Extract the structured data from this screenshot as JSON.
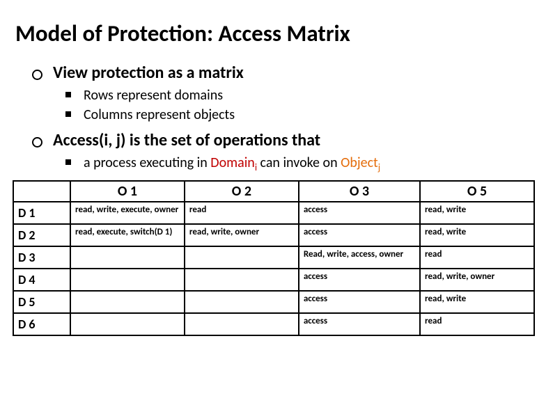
{
  "title": "Model of Protection: Access Matrix",
  "bullets": {
    "b1": {
      "text": "View protection as a matrix",
      "sub": {
        "s1": "Rows represent domains",
        "s2": "Columns represent objects"
      }
    },
    "b2": {
      "text": "Access(i, j) is the set of operations that",
      "sub_prefix": "a process executing in ",
      "sub_domain": "Domain",
      "sub_i": "i",
      "sub_mid": " can invoke on ",
      "sub_object": "Object",
      "sub_j": "j"
    }
  },
  "table": {
    "headers": {
      "h0": "",
      "h1": "O 1",
      "h2": "O 2",
      "h3": "O 3",
      "h4": "O 5"
    },
    "rows": [
      {
        "label": "D 1",
        "c1": "read, write, execute, owner",
        "c2": "read",
        "c3": "access",
        "c4": "read, write"
      },
      {
        "label": "D 2",
        "c1": "read, execute, switch(D 1)",
        "c2": "read, write, owner",
        "c3": "access",
        "c4": "read, write"
      },
      {
        "label": "D 3",
        "c1": "",
        "c2": "",
        "c3": "Read, write, access, owner",
        "c4": "read"
      },
      {
        "label": "D 4",
        "c1": "",
        "c2": "",
        "c3": "access",
        "c4": "read, write, owner"
      },
      {
        "label": "D 5",
        "c1": "",
        "c2": "",
        "c3": "access",
        "c4": "read, write"
      },
      {
        "label": "D 6",
        "c1": "",
        "c2": "",
        "c3": "access",
        "c4": "read"
      }
    ]
  },
  "chart_data": {
    "type": "table",
    "columns": [
      "O 1",
      "O 2",
      "O 3",
      "O 5"
    ],
    "rows": [
      "D 1",
      "D 2",
      "D 3",
      "D 4",
      "D 5",
      "D 6"
    ],
    "cells": [
      [
        "read, write, execute, owner",
        "read",
        "access",
        "read, write"
      ],
      [
        "read, execute, switch(D 1)",
        "read, write, owner",
        "access",
        "read, write"
      ],
      [
        "",
        "",
        "Read, write, access, owner",
        "read"
      ],
      [
        "",
        "",
        "access",
        "read, write, owner"
      ],
      [
        "",
        "",
        "access",
        "read, write"
      ],
      [
        "",
        "",
        "access",
        "read"
      ]
    ]
  }
}
